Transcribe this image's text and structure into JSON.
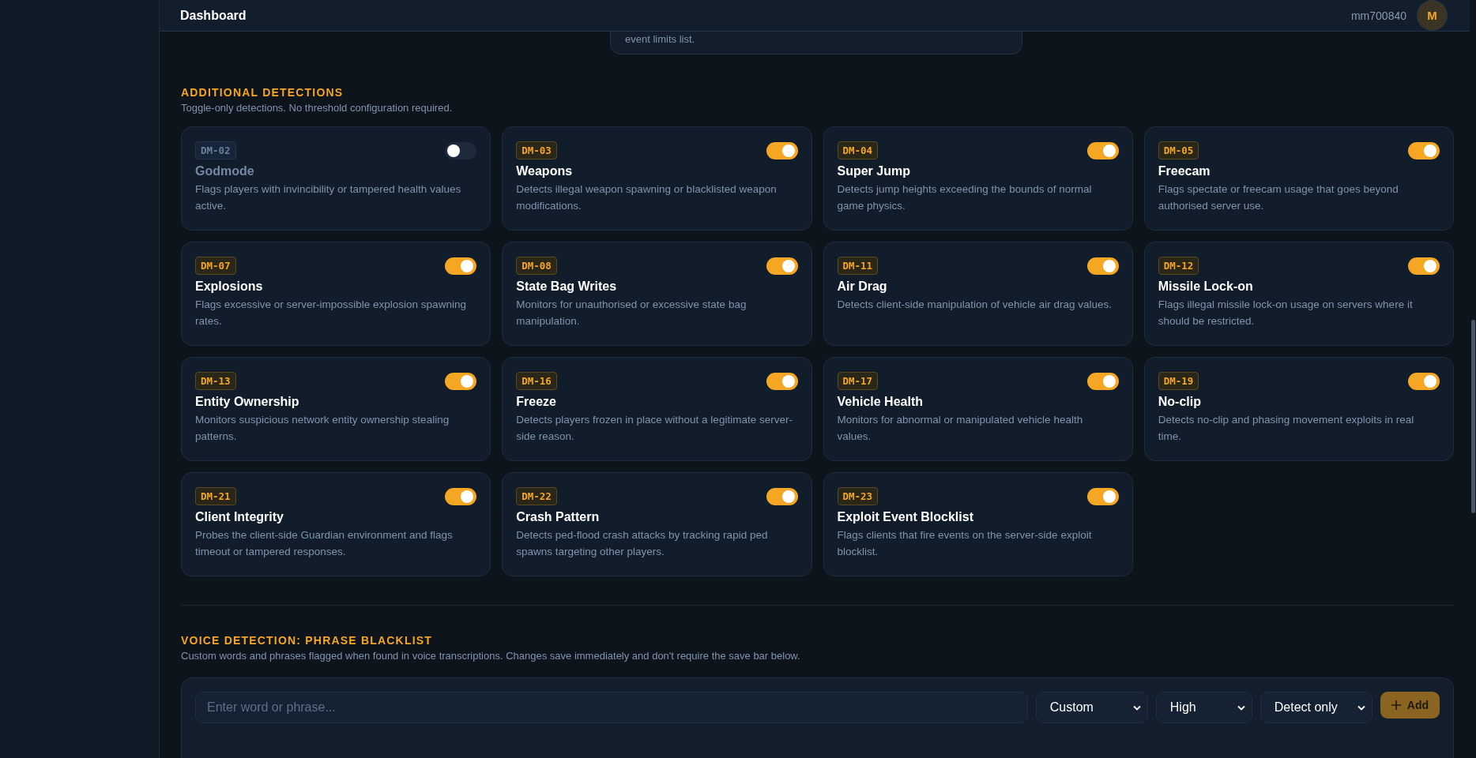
{
  "header": {
    "title": "Dashboard",
    "username": "mm700840",
    "avatar_initial": "M"
  },
  "partial_card": {
    "text": "event limits list."
  },
  "additional": {
    "title": "ADDITIONAL DETECTIONS",
    "subtitle": "Toggle-only detections. No threshold configuration required.",
    "detections": [
      {
        "code": "DM-02",
        "name": "Godmode",
        "description": "Flags players with invincibility or tampered health values active.",
        "on": false
      },
      {
        "code": "DM-03",
        "name": "Weapons",
        "description": "Detects illegal weapon spawning or blacklisted weapon modifications.",
        "on": true
      },
      {
        "code": "DM-04",
        "name": "Super Jump",
        "description": "Detects jump heights exceeding the bounds of normal game physics.",
        "on": true
      },
      {
        "code": "DM-05",
        "name": "Freecam",
        "description": "Flags spectate or freecam usage that goes beyond authorised server use.",
        "on": true
      },
      {
        "code": "DM-07",
        "name": "Explosions",
        "description": "Flags excessive or server-impossible explosion spawning rates.",
        "on": true
      },
      {
        "code": "DM-08",
        "name": "State Bag Writes",
        "description": "Monitors for unauthorised or excessive state bag manipulation.",
        "on": true
      },
      {
        "code": "DM-11",
        "name": "Air Drag",
        "description": "Detects client-side manipulation of vehicle air drag values.",
        "on": true
      },
      {
        "code": "DM-12",
        "name": "Missile Lock-on",
        "description": "Flags illegal missile lock-on usage on servers where it should be restricted.",
        "on": true
      },
      {
        "code": "DM-13",
        "name": "Entity Ownership",
        "description": "Monitors suspicious network entity ownership stealing patterns.",
        "on": true
      },
      {
        "code": "DM-16",
        "name": "Freeze",
        "description": "Detects players frozen in place without a legitimate server-side reason.",
        "on": true
      },
      {
        "code": "DM-17",
        "name": "Vehicle Health",
        "description": "Monitors for abnormal or manipulated vehicle health values.",
        "on": true
      },
      {
        "code": "DM-19",
        "name": "No-clip",
        "description": "Detects no-clip and phasing movement exploits in real time.",
        "on": true
      },
      {
        "code": "DM-21",
        "name": "Client Integrity",
        "description": "Probes the client-side Guardian environment and flags timeout or tampered responses.",
        "on": true
      },
      {
        "code": "DM-22",
        "name": "Crash Pattern",
        "description": "Detects ped-flood crash attacks by tracking rapid ped spawns targeting other players.",
        "on": true
      },
      {
        "code": "DM-23",
        "name": "Exploit Event Blocklist",
        "description": "Flags clients that fire events on the server-side exploit blocklist.",
        "on": true
      }
    ]
  },
  "voice": {
    "title": "VOICE DETECTION: PHRASE BLACKLIST",
    "subtitle": "Custom words and phrases flagged when found in voice transcriptions. Changes save immediately and don't require the save bar below.",
    "phrase_input": {
      "placeholder": "Enter word or phrase..."
    },
    "selects": [
      {
        "kind": "category",
        "value": "Custom"
      },
      {
        "kind": "severity",
        "value": "High"
      },
      {
        "kind": "action",
        "value": "Detect only"
      }
    ],
    "add_button": {
      "label": "Add"
    }
  }
}
